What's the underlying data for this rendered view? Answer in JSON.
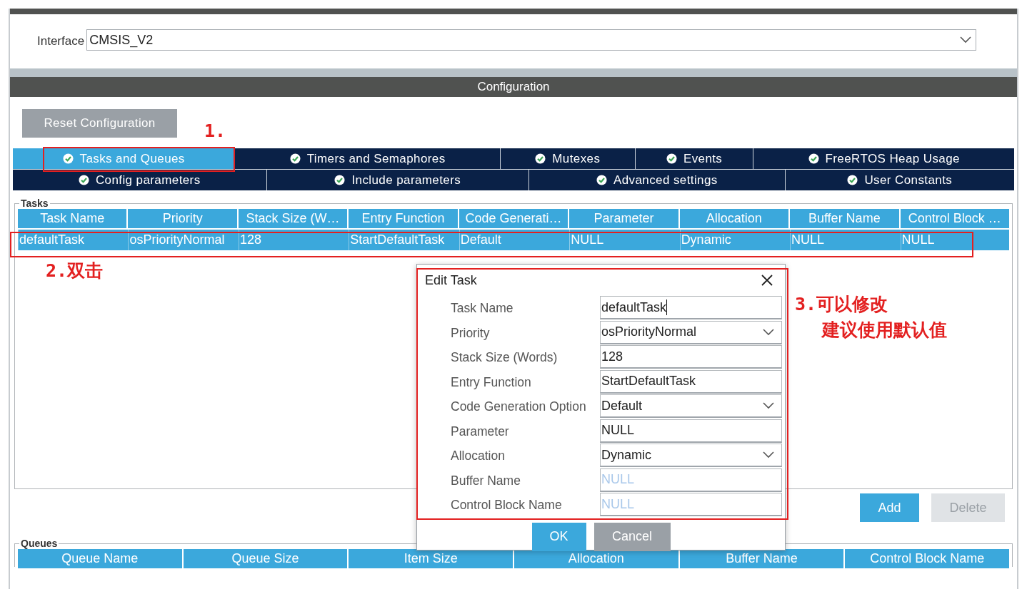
{
  "interface": {
    "label": "Interface",
    "value": "CMSIS_V2"
  },
  "configuration": {
    "title": "Configuration",
    "reset_button": "Reset Configuration",
    "tab_rows": [
      [
        {
          "label": "Tasks and Queues",
          "selected": true
        },
        {
          "label": "Timers and Semaphores",
          "selected": false
        },
        {
          "label": "Mutexes",
          "selected": false
        },
        {
          "label": "Events",
          "selected": false
        },
        {
          "label": "FreeRTOS Heap Usage",
          "selected": false
        }
      ],
      [
        {
          "label": "Config parameters",
          "selected": false
        },
        {
          "label": "Include parameters",
          "selected": false
        },
        {
          "label": "Advanced settings",
          "selected": false
        },
        {
          "label": "User Constants",
          "selected": false
        }
      ]
    ]
  },
  "tasks": {
    "legend": "Tasks",
    "columns": [
      "Task Name",
      "Priority",
      "Stack Size (W…",
      "Entry Function",
      "Code Generati…",
      "Parameter",
      "Allocation",
      "Buffer Name",
      "Control Block …"
    ],
    "rows": [
      {
        "cells": [
          "defaultTask",
          "osPriorityNormal",
          "128",
          "StartDefaultTask",
          "Default",
          "NULL",
          "Dynamic",
          "NULL",
          "NULL"
        ],
        "selected": true
      }
    ],
    "buttons": [
      {
        "label": "Add",
        "disabled": false
      },
      {
        "label": "Delete",
        "disabled": true
      }
    ]
  },
  "queues": {
    "legend": "Queues",
    "columns": [
      "Queue Name",
      "Queue Size",
      "Item Size",
      "Allocation",
      "Buffer Name",
      "Control Block Name"
    ]
  },
  "dialog": {
    "title": "Edit Task",
    "fields": [
      {
        "label": "Task Name",
        "kind": "text",
        "value": "defaultTask",
        "focused": true
      },
      {
        "label": "Priority",
        "kind": "select",
        "value": "osPriorityNormal"
      },
      {
        "label": "Stack Size (Words)",
        "kind": "text",
        "value": "128"
      },
      {
        "label": "Entry Function",
        "kind": "text",
        "value": "StartDefaultTask"
      },
      {
        "label": "Code Generation Option",
        "kind": "select",
        "value": "Default"
      },
      {
        "label": "Parameter",
        "kind": "text",
        "value": "NULL"
      },
      {
        "label": "Allocation",
        "kind": "select",
        "value": "Dynamic"
      },
      {
        "label": "Buffer Name",
        "kind": "text",
        "placeholder": "NULL"
      },
      {
        "label": "Control Block Name",
        "kind": "text",
        "placeholder": "NULL"
      }
    ],
    "buttons": [
      {
        "label": "OK",
        "kind": "primary"
      },
      {
        "label": "Cancel",
        "kind": "secondary"
      }
    ]
  },
  "annotations": [
    {
      "lines": [
        "1."
      ]
    },
    {
      "lines": [
        "2.双击"
      ]
    },
    {
      "lines": [
        "3.可以修改",
        "建议使用默认值"
      ]
    }
  ]
}
